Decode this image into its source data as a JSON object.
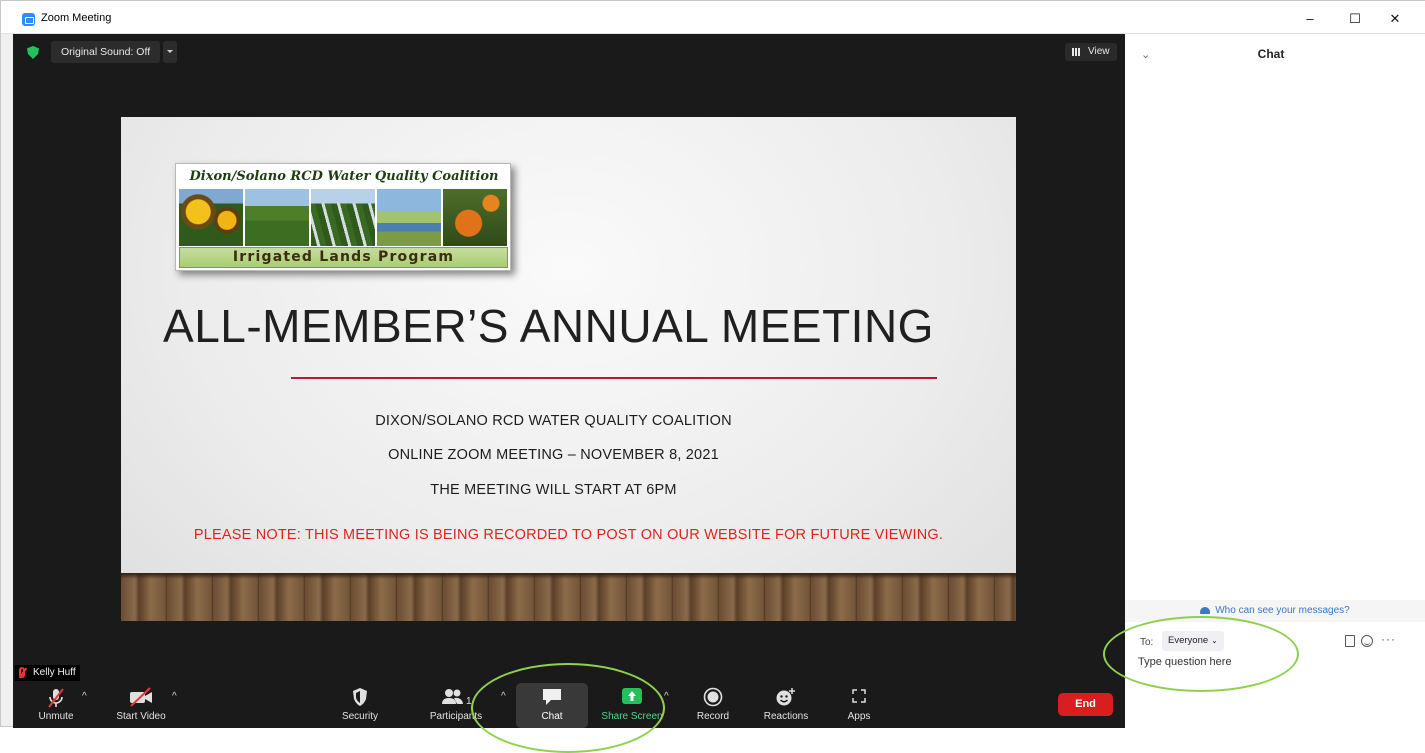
{
  "window": {
    "title": "Zoom Meeting",
    "minimize": "–",
    "maximize": "☐",
    "close": "✕"
  },
  "meeting": {
    "original_sound": "Original Sound: Off",
    "view_label": "View",
    "participant_name": "Kelly Huff"
  },
  "slide": {
    "logo_title": "Dixon/Solano RCD Water Quality Coalition",
    "logo_band": "Irrigated Lands Program",
    "heading": "ALL-MEMBER’S ANNUAL MEETING",
    "line1": "DIXON/SOLANO RCD WATER QUALITY COALITION",
    "line2": "ONLINE ZOOM MEETING – NOVEMBER 8, 2021",
    "line3": "THE MEETING WILL START AT 6PM",
    "note": "PLEASE NOTE: THIS MEETING IS BEING RECORDED TO POST ON OUR WEBSITE FOR FUTURE VIEWING."
  },
  "toolbar": {
    "unmute": "Unmute",
    "start_video": "Start Video",
    "security": "Security",
    "participants": "Participants",
    "participant_count": "1",
    "chat": "Chat",
    "share_screen": "Share Screen",
    "record": "Record",
    "reactions": "Reactions",
    "apps": "Apps",
    "end": "End",
    "caret": "^"
  },
  "chat": {
    "title": "Chat",
    "collapse": "⌄",
    "who_can_see": "Who can see your messages?",
    "to_label": "To:",
    "recipient": "Everyone",
    "recipient_caret": "⌄",
    "more": "···",
    "input_placeholder": "Type question here"
  },
  "colors": {
    "accent": "#2d8cff",
    "share_green": "#23c05b",
    "end_red": "#d81e1e",
    "annotation_green": "#8fd14f",
    "note_red": "#e0241f"
  }
}
